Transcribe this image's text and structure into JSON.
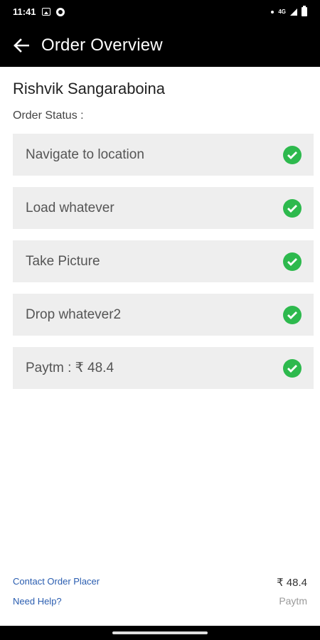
{
  "status_bar": {
    "time": "11:41",
    "network": "4G",
    "icons": [
      "image-icon",
      "circle-icon",
      "dot-icon",
      "signal-icon",
      "battery-icon"
    ]
  },
  "toolbar": {
    "back_icon": "arrow-left-icon",
    "title": "Order Overview"
  },
  "order": {
    "customer_name": "Rishvik Sangaraboina",
    "status_label": "Order Status :",
    "steps": [
      {
        "label": "Navigate to location",
        "icon": "check-circle-icon",
        "done": true
      },
      {
        "label": "Load whatever",
        "icon": "check-circle-icon",
        "done": true
      },
      {
        "label": "Take Picture",
        "icon": "check-circle-icon",
        "done": true
      },
      {
        "label": "Drop whatever2",
        "icon": "check-circle-icon",
        "done": true
      },
      {
        "label": "Paytm : ₹ 48.4",
        "icon": "check-circle-icon",
        "done": true
      }
    ]
  },
  "footer": {
    "contact_label": "Contact Order Placer",
    "help_label": "Need Help?",
    "amount": "₹ 48.4",
    "payment_method": "Paytm"
  },
  "colors": {
    "toolbar_bg": "#000000",
    "card_bg": "#eeeeee",
    "check": "#2db94d",
    "link": "#2a5db0"
  }
}
